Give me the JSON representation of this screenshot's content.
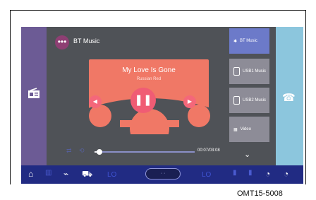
{
  "screen": {
    "source": {
      "title": "BT Music",
      "icon": "dots-icon",
      "accent": "#8e3f73"
    },
    "track": {
      "title": "My Love Is Gone",
      "artist": "Russian Red",
      "art_color": "#f07866",
      "progress_fraction": 0.05,
      "time_readout": "00:07/03:08"
    },
    "controls": {
      "previous_icon": "previous-icon",
      "pause_icon": "pause-icon",
      "next_icon": "next-icon",
      "shuffle_icon": "shuffle-icon",
      "repeat_icon": "repeat-icon"
    },
    "sources": [
      {
        "label": "BT Music",
        "active": true,
        "icon": "bluetooth-icon"
      },
      {
        "label": "USB1 Music",
        "active": false,
        "icon": "usb-icon"
      },
      {
        "label": "USB2 Music",
        "active": false,
        "icon": "usb-icon"
      },
      {
        "label": "Video",
        "active": false,
        "icon": "video-icon"
      }
    ],
    "left_rail": {
      "icon": "radio-icon"
    },
    "right_rail": {
      "icon": "phone-icon"
    },
    "bottom_bar": {
      "left_lo": "LO",
      "right_lo": "LO",
      "center_pill": "· ·",
      "icons": [
        "home-icon",
        "seat-heat-icon",
        "fan-icon",
        "car-icon",
        "seat-icon",
        "seat-icon",
        "fan-icon",
        "fan-icon"
      ]
    }
  },
  "caption": "OMT15-5008",
  "colors": {
    "background": "#4f5257",
    "left_rail": "#6c5b95",
    "right_rail": "#8cc6dd",
    "bottom_bar": "#212b83"
  }
}
